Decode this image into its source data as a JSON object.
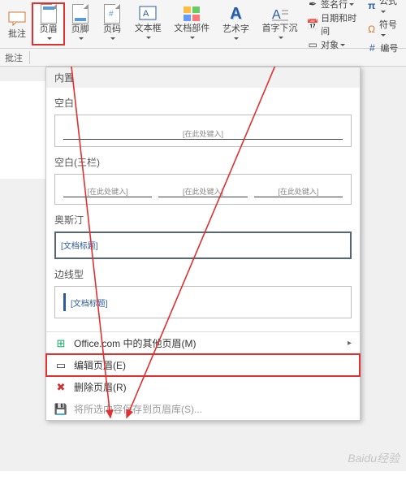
{
  "ribbon": {
    "comment": "批注",
    "header": "页眉",
    "footer": "页脚",
    "pageno": "页码",
    "textbox": "文本框",
    "docparts": "文档部件",
    "wordart": "艺术字",
    "dropcap": "首字下沉",
    "signature": "签名行",
    "datetime": "日期和时间",
    "object": "对象",
    "equation": "公式",
    "symbol": "符号",
    "number": "编号"
  },
  "row2": {
    "comment": "批注"
  },
  "dropdown": {
    "builtin": "内置",
    "g1": "空白",
    "ph": "[在此处键入]",
    "g2": "空白(三栏)",
    "g3": "奥斯汀",
    "ph3": "[文档标题]",
    "g4": "边线型",
    "ph4": "[文档标题]",
    "more": "Office.com 中的其他页眉(M)",
    "edit": "编辑页眉(E)",
    "remove": "删除页眉(R)",
    "save": "将所选内容保存到页眉库(S)..."
  },
  "watermark": "Baidu经验",
  "colors": {
    "highlight": "#e03030"
  }
}
